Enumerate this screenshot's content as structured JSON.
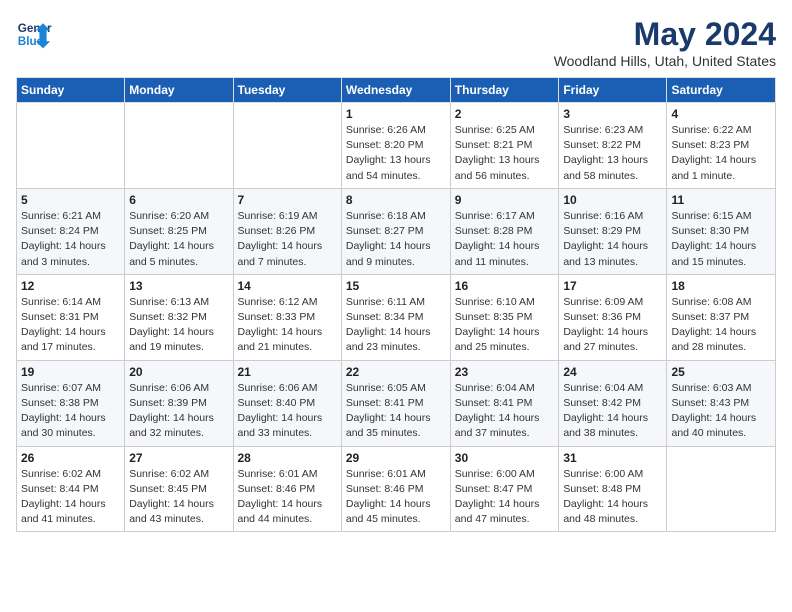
{
  "header": {
    "logo_line1": "General",
    "logo_line2": "Blue",
    "month": "May 2024",
    "location": "Woodland Hills, Utah, United States"
  },
  "weekdays": [
    "Sunday",
    "Monday",
    "Tuesday",
    "Wednesday",
    "Thursday",
    "Friday",
    "Saturday"
  ],
  "weeks": [
    [
      {
        "day": "",
        "info": ""
      },
      {
        "day": "",
        "info": ""
      },
      {
        "day": "",
        "info": ""
      },
      {
        "day": "1",
        "info": "Sunrise: 6:26 AM\nSunset: 8:20 PM\nDaylight: 13 hours\nand 54 minutes."
      },
      {
        "day": "2",
        "info": "Sunrise: 6:25 AM\nSunset: 8:21 PM\nDaylight: 13 hours\nand 56 minutes."
      },
      {
        "day": "3",
        "info": "Sunrise: 6:23 AM\nSunset: 8:22 PM\nDaylight: 13 hours\nand 58 minutes."
      },
      {
        "day": "4",
        "info": "Sunrise: 6:22 AM\nSunset: 8:23 PM\nDaylight: 14 hours\nand 1 minute."
      }
    ],
    [
      {
        "day": "5",
        "info": "Sunrise: 6:21 AM\nSunset: 8:24 PM\nDaylight: 14 hours\nand 3 minutes."
      },
      {
        "day": "6",
        "info": "Sunrise: 6:20 AM\nSunset: 8:25 PM\nDaylight: 14 hours\nand 5 minutes."
      },
      {
        "day": "7",
        "info": "Sunrise: 6:19 AM\nSunset: 8:26 PM\nDaylight: 14 hours\nand 7 minutes."
      },
      {
        "day": "8",
        "info": "Sunrise: 6:18 AM\nSunset: 8:27 PM\nDaylight: 14 hours\nand 9 minutes."
      },
      {
        "day": "9",
        "info": "Sunrise: 6:17 AM\nSunset: 8:28 PM\nDaylight: 14 hours\nand 11 minutes."
      },
      {
        "day": "10",
        "info": "Sunrise: 6:16 AM\nSunset: 8:29 PM\nDaylight: 14 hours\nand 13 minutes."
      },
      {
        "day": "11",
        "info": "Sunrise: 6:15 AM\nSunset: 8:30 PM\nDaylight: 14 hours\nand 15 minutes."
      }
    ],
    [
      {
        "day": "12",
        "info": "Sunrise: 6:14 AM\nSunset: 8:31 PM\nDaylight: 14 hours\nand 17 minutes."
      },
      {
        "day": "13",
        "info": "Sunrise: 6:13 AM\nSunset: 8:32 PM\nDaylight: 14 hours\nand 19 minutes."
      },
      {
        "day": "14",
        "info": "Sunrise: 6:12 AM\nSunset: 8:33 PM\nDaylight: 14 hours\nand 21 minutes."
      },
      {
        "day": "15",
        "info": "Sunrise: 6:11 AM\nSunset: 8:34 PM\nDaylight: 14 hours\nand 23 minutes."
      },
      {
        "day": "16",
        "info": "Sunrise: 6:10 AM\nSunset: 8:35 PM\nDaylight: 14 hours\nand 25 minutes."
      },
      {
        "day": "17",
        "info": "Sunrise: 6:09 AM\nSunset: 8:36 PM\nDaylight: 14 hours\nand 27 minutes."
      },
      {
        "day": "18",
        "info": "Sunrise: 6:08 AM\nSunset: 8:37 PM\nDaylight: 14 hours\nand 28 minutes."
      }
    ],
    [
      {
        "day": "19",
        "info": "Sunrise: 6:07 AM\nSunset: 8:38 PM\nDaylight: 14 hours\nand 30 minutes."
      },
      {
        "day": "20",
        "info": "Sunrise: 6:06 AM\nSunset: 8:39 PM\nDaylight: 14 hours\nand 32 minutes."
      },
      {
        "day": "21",
        "info": "Sunrise: 6:06 AM\nSunset: 8:40 PM\nDaylight: 14 hours\nand 33 minutes."
      },
      {
        "day": "22",
        "info": "Sunrise: 6:05 AM\nSunset: 8:41 PM\nDaylight: 14 hours\nand 35 minutes."
      },
      {
        "day": "23",
        "info": "Sunrise: 6:04 AM\nSunset: 8:41 PM\nDaylight: 14 hours\nand 37 minutes."
      },
      {
        "day": "24",
        "info": "Sunrise: 6:04 AM\nSunset: 8:42 PM\nDaylight: 14 hours\nand 38 minutes."
      },
      {
        "day": "25",
        "info": "Sunrise: 6:03 AM\nSunset: 8:43 PM\nDaylight: 14 hours\nand 40 minutes."
      }
    ],
    [
      {
        "day": "26",
        "info": "Sunrise: 6:02 AM\nSunset: 8:44 PM\nDaylight: 14 hours\nand 41 minutes."
      },
      {
        "day": "27",
        "info": "Sunrise: 6:02 AM\nSunset: 8:45 PM\nDaylight: 14 hours\nand 43 minutes."
      },
      {
        "day": "28",
        "info": "Sunrise: 6:01 AM\nSunset: 8:46 PM\nDaylight: 14 hours\nand 44 minutes."
      },
      {
        "day": "29",
        "info": "Sunrise: 6:01 AM\nSunset: 8:46 PM\nDaylight: 14 hours\nand 45 minutes."
      },
      {
        "day": "30",
        "info": "Sunrise: 6:00 AM\nSunset: 8:47 PM\nDaylight: 14 hours\nand 47 minutes."
      },
      {
        "day": "31",
        "info": "Sunrise: 6:00 AM\nSunset: 8:48 PM\nDaylight: 14 hours\nand 48 minutes."
      },
      {
        "day": "",
        "info": ""
      }
    ]
  ]
}
